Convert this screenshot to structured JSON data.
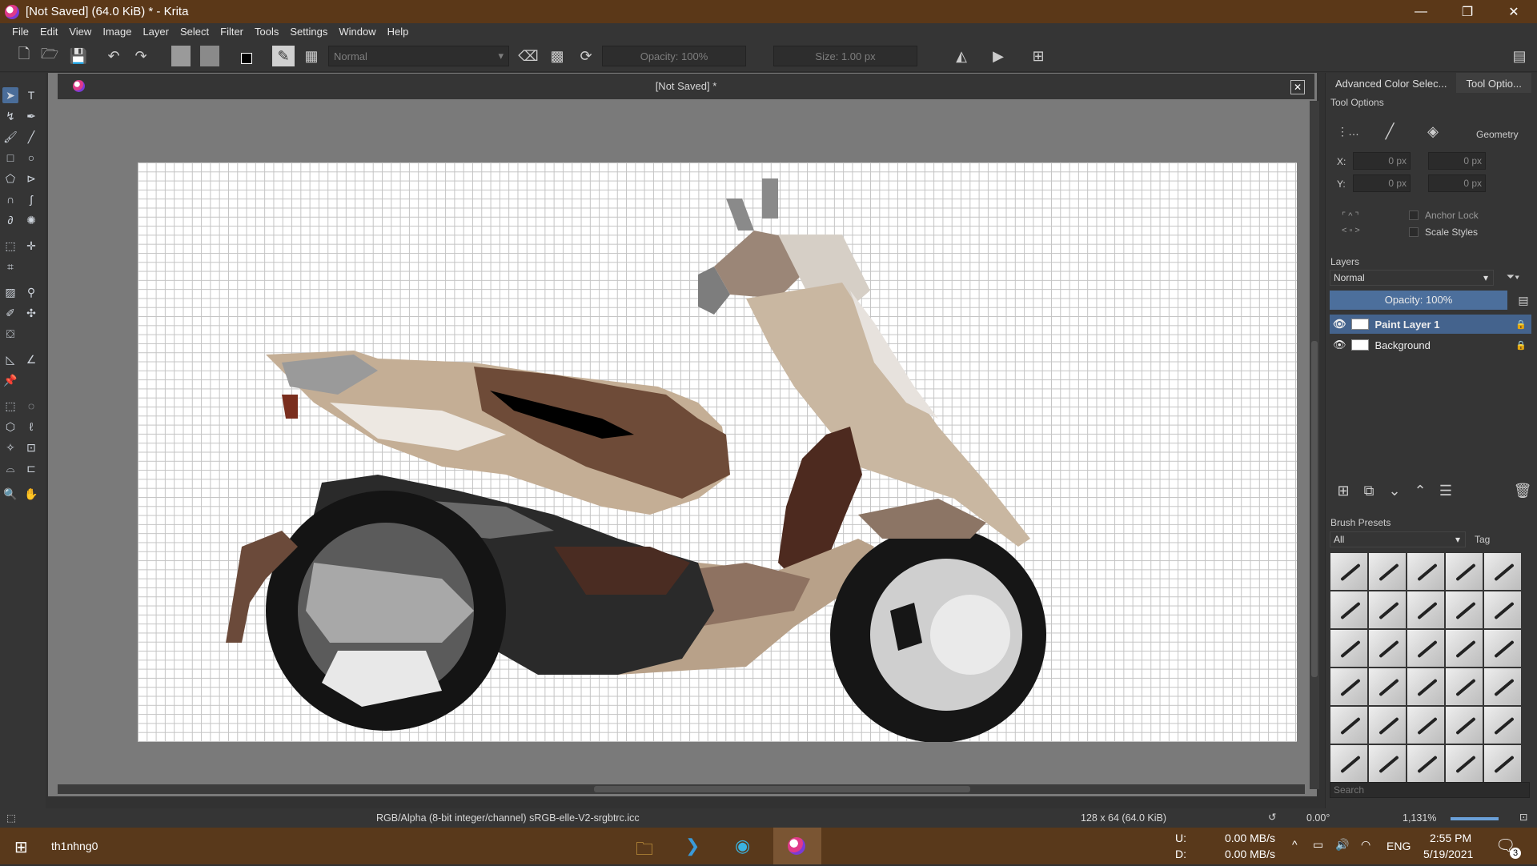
{
  "window": {
    "title": "[Not Saved]  (64.0 KiB)  * - Krita",
    "minimize": "—",
    "maximize": "❐",
    "close": "✕"
  },
  "menu": [
    "File",
    "Edit",
    "View",
    "Image",
    "Layer",
    "Select",
    "Filter",
    "Tools",
    "Settings",
    "Window",
    "Help"
  ],
  "toolbar": {
    "blend_mode": "Normal",
    "opacity": "Opacity: 100%",
    "size": "Size: 1.00 px"
  },
  "document": {
    "tab_title": "[Not Saved]  *",
    "close": "✕"
  },
  "dock": {
    "tabs": [
      "Advanced Color Selec...",
      "Tool Optio..."
    ],
    "tool_options": {
      "title": "Tool Options",
      "geometry_label": "Geometry",
      "x_label": "X:",
      "y_label": "Y:",
      "x1": "0 px",
      "x2": "0 px",
      "y1": "0 px",
      "y2": "0 px",
      "anchor_lock": "Anchor Lock",
      "scale_styles": "Scale Styles"
    },
    "layers": {
      "title": "Layers",
      "blend_mode": "Normal",
      "opacity": "Opacity:  100%",
      "items": [
        {
          "name": "Paint Layer 1",
          "selected": true
        },
        {
          "name": "Background",
          "selected": false
        }
      ]
    },
    "brush_presets": {
      "title": "Brush Presets",
      "filter": "All",
      "tag": "Tag",
      "search_placeholder": "Search"
    }
  },
  "status": {
    "color_profile": "RGB/Alpha (8-bit integer/channel)  sRGB-elle-V2-srgbtrc.icc",
    "image_size": "128 x 64 (64.0 KiB)",
    "rotation": "0.00°",
    "zoom": "1,131%"
  },
  "taskbar": {
    "user": "th1nhng0",
    "upload_label": "U:",
    "upload": "0.00 MB/s",
    "download_label": "D:",
    "download": "0.00 MB/s",
    "lang": "ENG",
    "time": "2:55 PM",
    "date": "5/19/2021",
    "notif_count": "3"
  }
}
